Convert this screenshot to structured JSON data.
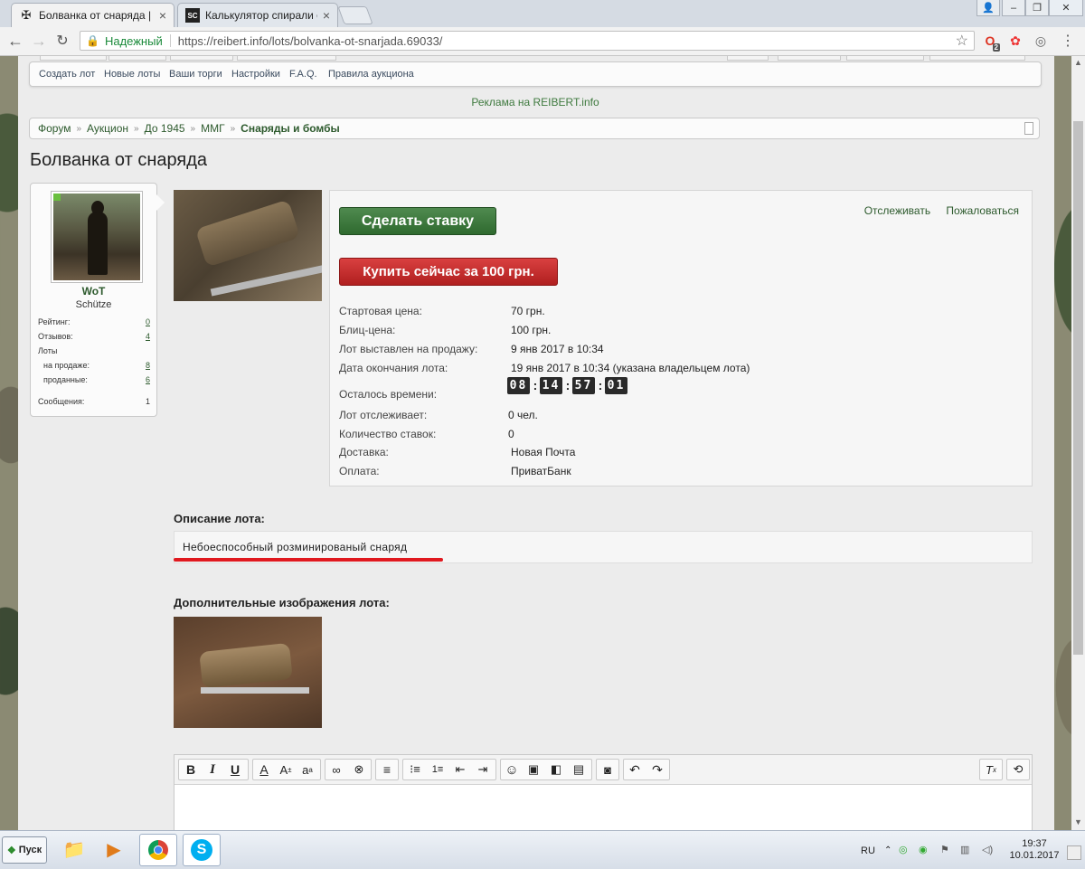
{
  "browser": {
    "tabs": [
      {
        "title": "Болванка от снаряда | R",
        "icon": "iron-cross-icon",
        "active": true
      },
      {
        "title": "Калькулятор спирали ог",
        "icon": "sc-icon",
        "active": false
      }
    ],
    "address": {
      "secure_label": "Надежный",
      "url": "https://reibert.info/lots/bolvanka-ot-snarjada.69033/"
    },
    "extension_badge": "2"
  },
  "nav": {
    "links": [
      "Создать лот",
      "Новые лоты",
      "Ваши торги",
      "Настройки",
      "F.A.Q.",
      "Правила аукциона"
    ]
  },
  "ad_text": "Реклама на REIBERT.info",
  "breadcrumb": {
    "items": [
      "Форум",
      "Аукцион",
      "До 1945",
      "ММГ"
    ],
    "current": "Снаряды и бомбы",
    "separator": "»"
  },
  "page_title": "Болванка от снаряда",
  "seller": {
    "name": "WoT",
    "rank": "Schütze",
    "stats": [
      {
        "label": "Рейтинг:",
        "value": "0",
        "link": true
      },
      {
        "label": "Отзывов:",
        "value": "4",
        "link": true
      },
      {
        "label": "Лоты",
        "value": "",
        "link": false
      },
      {
        "label": "на продаже:",
        "value": "8",
        "link": true
      },
      {
        "label": "проданные:",
        "value": "6",
        "link": true
      },
      {
        "label": "Сообщения:",
        "value": "1",
        "link": false
      }
    ]
  },
  "lot": {
    "bid_button": "Сделать ставку",
    "buy_button": "Купить сейчас за 100 грн.",
    "watch_link": "Отслеживать",
    "report_link": "Пожаловаться",
    "fields": [
      {
        "label": "Стартовая цена:",
        "value": "70 грн."
      },
      {
        "label": "Блиц-цена:",
        "value": "100 грн."
      },
      {
        "label": "Лот выставлен на продажу:",
        "value": "9 янв 2017 в 10:34"
      },
      {
        "label": "Дата окончания лота:",
        "value": "19 янв 2017 в 10:34 (указана владельцем лота)"
      }
    ],
    "time_left_label": "Осталось времени:",
    "time_left": {
      "days": "08",
      "hours": "14",
      "minutes": "57",
      "seconds": "01"
    },
    "fields2": [
      {
        "label": "Лот отслеживает:",
        "value": "0 чел."
      },
      {
        "label": "Количество ставок:",
        "value": "0"
      },
      {
        "label": "Доставка:",
        "value": "Новая Почта"
      },
      {
        "label": "Оплата:",
        "value": "ПриватБанк"
      }
    ]
  },
  "description": {
    "title": "Описание лота:",
    "text": "Небоеспособный розминированый снаряд"
  },
  "extra_images_title": "Дополнительные изображения лота:",
  "editor": {
    "buttons": [
      "bold-icon",
      "italic-icon",
      "underline-icon",
      "text-color-icon",
      "font-size-icon",
      "font-style-icon",
      "link-icon",
      "unlink-icon",
      "align-icon",
      "bullet-list-icon",
      "number-list-icon",
      "outdent-icon",
      "indent-icon",
      "smiley-icon",
      "image-icon",
      "media-icon",
      "template-icon",
      "camera-icon",
      "undo-icon",
      "redo-icon",
      "remove-format-icon",
      "toggle-bbcode-icon"
    ]
  },
  "taskbar": {
    "start_label": "Пуск",
    "lang": "RU",
    "time": "19:37",
    "date": "10.01.2017"
  }
}
